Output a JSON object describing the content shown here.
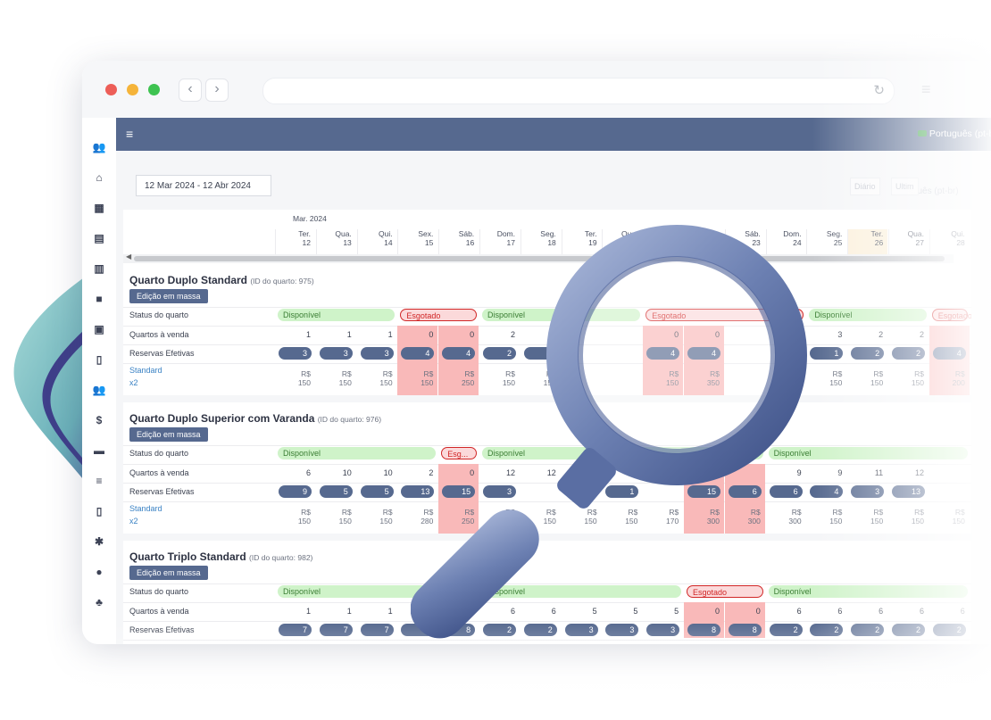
{
  "browser": {
    "back_icon": "chevron-left-icon",
    "forward_icon": "chevron-right-icon",
    "reload_glyph": "↻"
  },
  "header": {
    "menu_glyph": "≡",
    "language": "Português (pt-br)",
    "language_ghost": "Português (pt-br)"
  },
  "toolbar": {
    "date_range": "12 Mar 2024 - 12 Abr 2024",
    "ghost_buttons": [
      "Diário",
      "Ultim"
    ]
  },
  "calendar": {
    "month": "Mar. 2024",
    "days": [
      {
        "dow": "Ter.",
        "day": "12"
      },
      {
        "dow": "Qua.",
        "day": "13"
      },
      {
        "dow": "Qui.",
        "day": "14"
      },
      {
        "dow": "Sex.",
        "day": "15"
      },
      {
        "dow": "Sáb.",
        "day": "16"
      },
      {
        "dow": "Dom.",
        "day": "17"
      },
      {
        "dow": "Seg.",
        "day": "18"
      },
      {
        "dow": "Ter.",
        "day": "19"
      },
      {
        "dow": "Qua.",
        "day": "20"
      },
      {
        "dow": "Qui.",
        "day": "21"
      },
      {
        "dow": "Sex.",
        "day": "22"
      },
      {
        "dow": "Sáb.",
        "day": "23"
      },
      {
        "dow": "Dom.",
        "day": "24"
      },
      {
        "dow": "Seg.",
        "day": "25"
      },
      {
        "dow": "Ter.",
        "day": "26"
      },
      {
        "dow": "Qua.",
        "day": "27"
      },
      {
        "dow": "Qui.",
        "day": "28"
      }
    ]
  },
  "labels": {
    "status": "Status do quarto",
    "for_sale": "Quartos à venda",
    "bookings": "Reservas Efetivas",
    "bulk_edit": "Edição em massa",
    "plan": "Standard",
    "occupancy": "x2",
    "available": "Disponível",
    "sold_out": "Esgotado",
    "sold_out_short": "Esg..."
  },
  "rooms": [
    {
      "name": "Quarto Duplo Standard",
      "id_text": "(ID do quarto: 975)",
      "for_sale": [
        "1",
        "1",
        "1",
        "0",
        "0",
        "2",
        "3",
        "",
        "",
        "0",
        "0",
        "",
        "",
        "3",
        "2",
        "2",
        ""
      ],
      "bookings": [
        "3",
        "3",
        "3",
        "4",
        "4",
        "2",
        "1",
        "",
        "",
        "4",
        "4",
        "",
        "",
        "1",
        "2",
        "2",
        "4"
      ],
      "prices": [
        [
          "R$",
          "150"
        ],
        [
          "R$",
          "150"
        ],
        [
          "R$",
          "150"
        ],
        [
          "R$",
          "150"
        ],
        [
          "R$",
          "250"
        ],
        [
          "R$",
          "150"
        ],
        [
          "R$",
          "150"
        ],
        [
          "",
          ""
        ],
        [
          "",
          ""
        ],
        [
          "R$",
          "150"
        ],
        [
          "R$",
          "350"
        ],
        [
          "",
          ""
        ],
        [
          "",
          ""
        ],
        [
          "R$",
          "150"
        ],
        [
          "R$",
          "150"
        ],
        [
          "R$",
          "150"
        ],
        [
          "R$",
          "200"
        ]
      ]
    },
    {
      "name": "Quarto Duplo Superior com Varanda",
      "id_text": "(ID do quarto: 976)",
      "for_sale": [
        "6",
        "10",
        "10",
        "2",
        "0",
        "12",
        "12",
        "",
        "",
        "",
        "",
        "",
        "9",
        "9",
        "11",
        "12",
        ""
      ],
      "bookings": [
        "9",
        "5",
        "5",
        "13",
        "15",
        "3",
        "",
        "3",
        "1",
        "",
        "15",
        "6",
        "6",
        "4",
        "3",
        "13",
        ""
      ],
      "prices": [
        [
          "R$",
          "150"
        ],
        [
          "R$",
          "150"
        ],
        [
          "R$",
          "150"
        ],
        [
          "R$",
          "280"
        ],
        [
          "R$",
          "250"
        ],
        [
          "R$",
          "150"
        ],
        [
          "R$",
          "150"
        ],
        [
          "R$",
          "150"
        ],
        [
          "R$",
          "150"
        ],
        [
          "R$",
          "170"
        ],
        [
          "R$",
          "300"
        ],
        [
          "R$",
          "300"
        ],
        [
          "R$",
          "300"
        ],
        [
          "R$",
          "150"
        ],
        [
          "R$",
          "150"
        ],
        [
          "R$",
          "150"
        ],
        [
          "R$",
          "150"
        ]
      ]
    },
    {
      "name": "Quarto Triplo Standard",
      "id_text": "(ID do quarto: 982)",
      "for_sale": [
        "1",
        "1",
        "1",
        "",
        "0",
        "6",
        "6",
        "5",
        "5",
        "5",
        "0",
        "0",
        "6",
        "6",
        "6",
        "6",
        "6"
      ],
      "bookings": [
        "7",
        "7",
        "7",
        "6",
        "8",
        "2",
        "2",
        "3",
        "3",
        "3",
        "8",
        "8",
        "2",
        "2",
        "2",
        "2",
        "2"
      ]
    }
  ],
  "colors": {
    "primary": "#56698f",
    "available": "#cff3c9",
    "sold_out": "#fbd9da",
    "sold_out_cell": "#f9b9b9"
  }
}
